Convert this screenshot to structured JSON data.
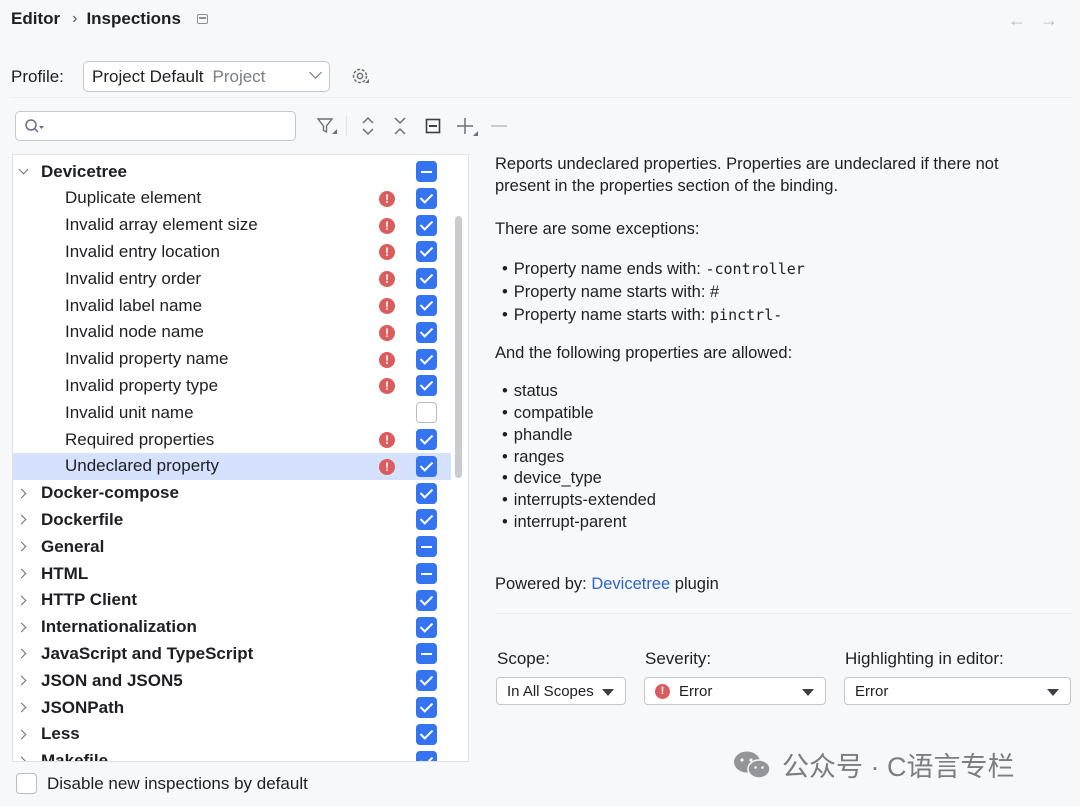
{
  "header": {
    "breadcrumb_root": "Editor",
    "breadcrumb_sep": "›",
    "breadcrumb_current": "Inspections",
    "back_icon": "arrow-left-icon",
    "forward_icon": "arrow-right-icon",
    "back_glyph": "←",
    "forward_glyph": "→"
  },
  "profile": {
    "label": "Profile:",
    "value": "Project Default",
    "value_sub": "Project"
  },
  "search": {
    "value": "",
    "placeholder": ""
  },
  "tree": {
    "groups_top": {
      "label": "Devicetree",
      "state": "mixed",
      "items": [
        {
          "label": "Duplicate element",
          "error": true,
          "checked": true
        },
        {
          "label": "Invalid array element size",
          "error": true,
          "checked": true
        },
        {
          "label": "Invalid entry location",
          "error": true,
          "checked": true
        },
        {
          "label": "Invalid entry order",
          "error": true,
          "checked": true
        },
        {
          "label": "Invalid label name",
          "error": true,
          "checked": true
        },
        {
          "label": "Invalid node name",
          "error": true,
          "checked": true
        },
        {
          "label": "Invalid property name",
          "error": true,
          "checked": true
        },
        {
          "label": "Invalid property type",
          "error": true,
          "checked": true
        },
        {
          "label": "Invalid unit name",
          "error": false,
          "checked": false
        },
        {
          "label": "Required properties",
          "error": true,
          "checked": true
        },
        {
          "label": "Undeclared property",
          "error": true,
          "checked": true,
          "selected": true
        }
      ]
    },
    "other_groups": [
      {
        "label": "Docker-compose",
        "state": "checked"
      },
      {
        "label": "Dockerfile",
        "state": "checked"
      },
      {
        "label": "General",
        "state": "mixed"
      },
      {
        "label": "HTML",
        "state": "mixed"
      },
      {
        "label": "HTTP Client",
        "state": "checked"
      },
      {
        "label": "Internationalization",
        "state": "checked"
      },
      {
        "label": "JavaScript and TypeScript",
        "state": "mixed"
      },
      {
        "label": "JSON and JSON5",
        "state": "checked"
      },
      {
        "label": "JSONPath",
        "state": "checked"
      },
      {
        "label": "Less",
        "state": "checked"
      },
      {
        "label": "Makefile",
        "state": "checked"
      }
    ],
    "error_glyph": "!"
  },
  "bottom": {
    "disable_label": "Disable new inspections by default"
  },
  "description": {
    "para1_line1": "Reports undeclared properties. Properties are undeclared if there not",
    "para1_line2": "present in the properties section of the binding.",
    "para2": "There are some exceptions:",
    "exceptions": [
      {
        "text": "Property name ends with: ",
        "code": "-controller"
      },
      {
        "text": "Property name starts with: #",
        "code": ""
      },
      {
        "text": "Property name starts with: ",
        "code": "pinctrl-"
      }
    ],
    "para3": "And the following properties are allowed:",
    "allowed": [
      "status",
      "compatible",
      "phandle",
      "ranges",
      "device_type",
      "interrupts-extended",
      "interrupt-parent"
    ],
    "powered_prefix": "Powered by: ",
    "powered_link": "Devicetree",
    "powered_suffix": " plugin"
  },
  "options": {
    "scope_label": "Scope:",
    "scope_value": "In All Scopes",
    "severity_label": "Severity:",
    "severity_value": "Error",
    "highlight_label": "Highlighting in editor:",
    "highlight_value": "Error"
  },
  "watermark": {
    "text": "公众号 · C语言专栏"
  },
  "colors": {
    "accent": "#3574f0",
    "error": "#db5c5c",
    "link": "#2e62c8",
    "selection": "#d5e1fd"
  }
}
